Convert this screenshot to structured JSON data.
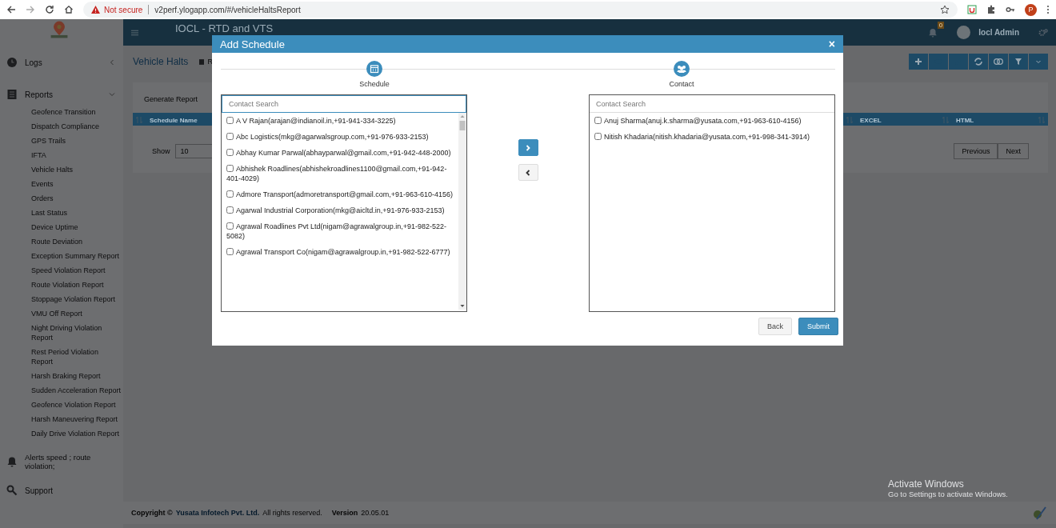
{
  "browser": {
    "warning": "Not secure",
    "url": "v2perf.ylogapp.com/#/vehicleHaltsReport",
    "profile_initial": "P"
  },
  "header": {
    "title": "IOCL - RTD and VTS",
    "notification_count": "0",
    "user": "Iocl Admin"
  },
  "sidebar": {
    "sections": [
      {
        "kind": "group",
        "label": "Logs",
        "expanded": false
      },
      {
        "kind": "group",
        "label": "Reports",
        "expanded": true,
        "children": [
          "Geofence Transition",
          "Dispatch Compliance",
          "GPS Trails",
          "IFTA",
          "Vehicle Halts",
          "Events",
          "Orders",
          "Last Status",
          "Device Uptime",
          "Route Deviation",
          "Exception Summary Report",
          "Speed Violation Report",
          "Route Violation Report",
          "Stoppage Violation Report",
          "VMU Off Report",
          "Night Driving Violation Report",
          "Rest Period Violation Report",
          "Harsh Braking Report",
          "Sudden Acceleration Report",
          "Geofence Violation Report",
          "Harsh Maneuvering Report",
          "Daily Drive Violation Report"
        ]
      },
      {
        "kind": "alert",
        "label": "Alerts speed ; route violation;"
      },
      {
        "kind": "support",
        "label": "Support"
      }
    ]
  },
  "page": {
    "title": "Vehicle Halts",
    "breadcrumb": "R",
    "tab": "Generate Report",
    "columns": [
      "Schedule Name",
      "EXCEL",
      "HTML"
    ],
    "show_label": "Show",
    "page_size": "10",
    "pager": [
      "Previous",
      "Next"
    ]
  },
  "footer": {
    "copyright": "Copyright ©",
    "company": "Yusata Infotech Pvt. Ltd.",
    "rights": "All rights reserved.",
    "version_label": "Version",
    "version": "20.05.01"
  },
  "os_notice": {
    "title": "Activate Windows",
    "text": "Go to Settings to activate Windows."
  },
  "modal": {
    "title": "Add Schedule",
    "close": "×",
    "steps": [
      "Schedule",
      "Contact"
    ],
    "available": {
      "placeholder": "Contact Search",
      "items": [
        {
          "label": "A V Rajan(arajan@indianoil.in,+91-941-334-3225)",
          "checked": false
        },
        {
          "label": "Abc Logistics(mkg@agarwalsgroup.com,+91-976-933-2153)",
          "checked": false
        },
        {
          "label": "Abhay Kumar Parwal(abhayparwal@gmail.com,+91-942-448-2000)",
          "checked": false
        },
        {
          "label": "Abhishek Roadlines(abhishekroadlines1100@gmail.com,+91-942-401-4029)",
          "checked": false
        },
        {
          "label": "Admore Transport(admoretransport@gmail.com,+91-963-610-4156)",
          "checked": false
        },
        {
          "label": "Agarwal Industrial Corporation(mkg@aicltd.in,+91-976-933-2153)",
          "checked": false
        },
        {
          "label": "Agrawal Roadlines Pvt Ltd(nigam@agrawalgroup.in,+91-982-522-5082)",
          "checked": false
        },
        {
          "label": "Agrawal Transport Co(nigam@agrawalgroup.in,+91-982-522-6777)",
          "checked": false
        }
      ]
    },
    "selected": {
      "placeholder": "Contact Search",
      "items": [
        {
          "label": "Anuj Sharma(anuj.k.sharma@yusata.com,+91-963-610-4156)",
          "checked": false
        },
        {
          "label": "Nitish Khadaria(nitish.khadaria@yusata.com,+91-998-341-3914)",
          "checked": false
        }
      ]
    },
    "move_buttons": [
      {
        "kind": "right",
        "selected": true
      },
      {
        "kind": "left",
        "selected": false
      }
    ],
    "actions": [
      "Back",
      "Submit"
    ]
  }
}
